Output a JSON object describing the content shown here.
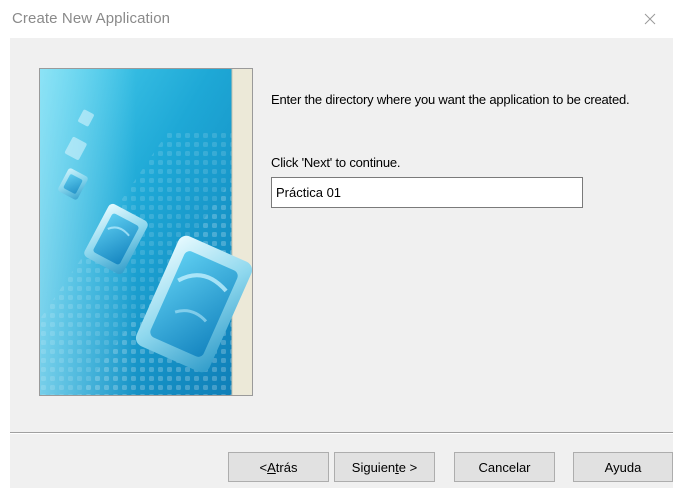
{
  "window": {
    "title": "Create New Application",
    "close_icon": "close-icon"
  },
  "image": {
    "icon": "wizard-graphic"
  },
  "main": {
    "instructions": "Enter the directory where you want the application to be created.",
    "continue_label": "Click 'Next' to continue.",
    "directory_value": "Práctica 01"
  },
  "buttons": {
    "back": {
      "pre": "< ",
      "mnemonic": "A",
      "post": "trás"
    },
    "next": {
      "pre": "Siguien",
      "mnemonic": "t",
      "post": "e >"
    },
    "cancel": "Cancelar",
    "help": "Ayuda"
  },
  "colors": {
    "dialog_bg": "#f0f0f0",
    "title_text": "#8a8a8a",
    "image_primary": "#1ea8d6",
    "image_side_strip": "#ece9d8"
  }
}
